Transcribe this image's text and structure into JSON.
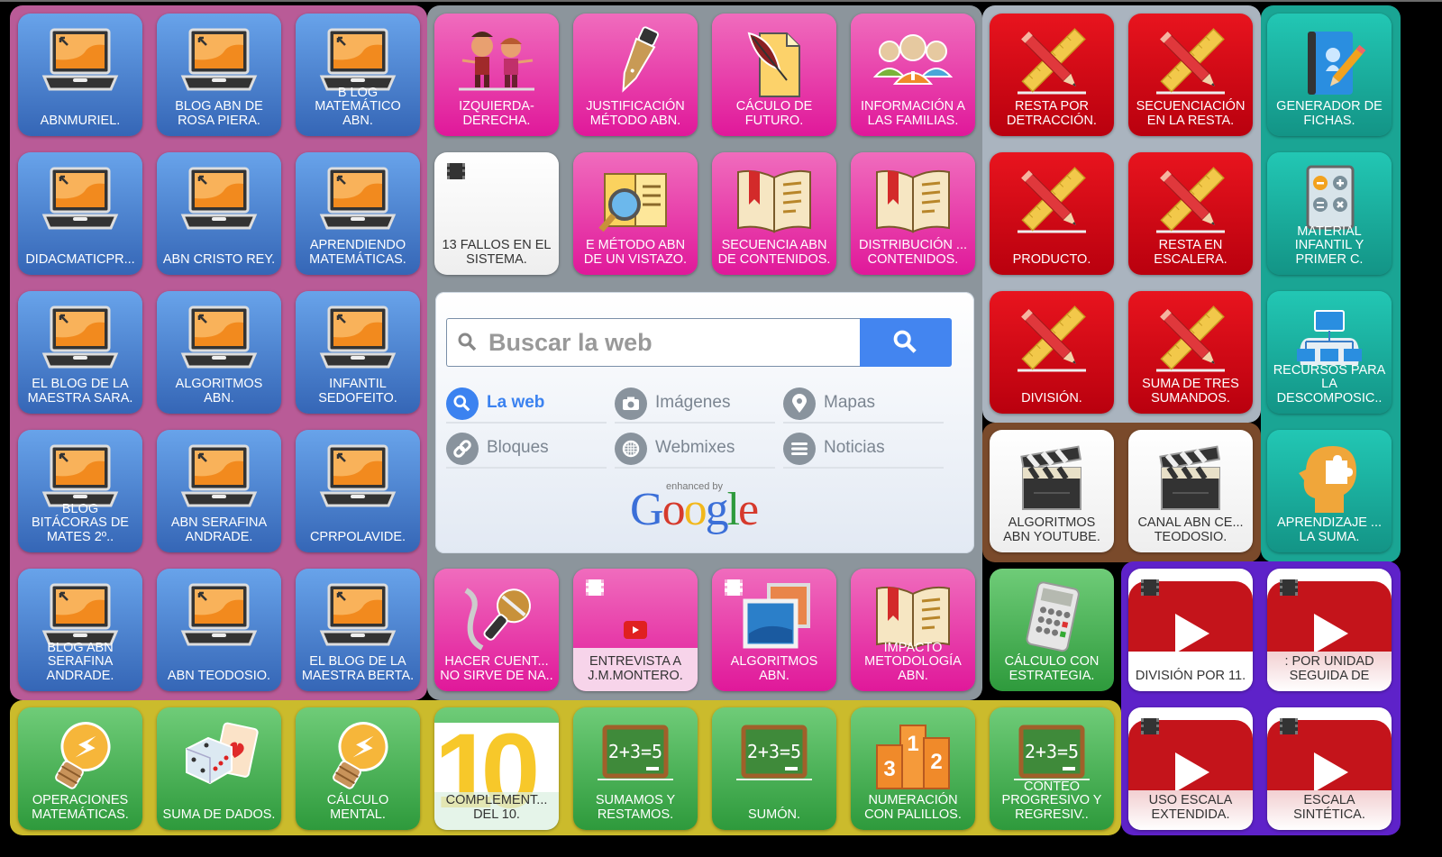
{
  "colors": {
    "group_blue_bg": "#b95b97",
    "group_pink_bg": "#8c959c",
    "group_red_bg": "#aab4bf",
    "group_teal_bg": "#1aa594",
    "group_brown_bg": "#7a4a2b",
    "group_yellow_bg": "#cbbb2c",
    "group_purple_bg": "#5e22c9",
    "search_accent": "#4385f0"
  },
  "tiles": {
    "abnmuriel": "ABNMURIEL.",
    "blog_rosa": "BLOG ABN DE\nROSA PIERA.",
    "blog_matematico": "B LOG\nMATEMÁTICO\nABN.",
    "didacmatic": "DIDACMATICPR...",
    "cristo_rey": "ABN CRISTO REY.",
    "aprendiendo": "APRENDIENDO\nMATEMÁTICAS.",
    "maestra_sara": "EL BLOG DE LA\nMAESTRA SARA.",
    "algoritmos_blog": "ALGORITMOS\nABN.",
    "sedofeito": "INFANTIL\nSEDOFEITO.",
    "bitacoras": "BLOG\nBITÁCORAS DE\nMATES  2º..",
    "serafina": "ABN SERAFINA\nANDRADE.",
    "cprpolavide": "CPRPOLAVIDE.",
    "blog_serafina": "BLOG ABN\nSERAFINA\nANDRADE.",
    "teodosio": "ABN TEODOSIO.",
    "maestra_berta": "EL BLOG DE LA\nMAESTRA BERTA.",
    "izquierda": "IZQUIERDA-\nDERECHA.",
    "justificacion": "JUSTIFICACIÓN\nMÉTODO ABN.",
    "caculo_futuro": "CÁCULO DE\nFUTURO.",
    "informacion": "INFORMACIÓN A\nLAS FAMILIAS.",
    "fallos": "13 FALLOS EN EL\nSISTEMA.",
    "vistazo": "E MÉTODO ABN\nDE UN VISTAZO.",
    "secuencia": "SECUENCIA ABN\nDE CONTENIDOS.",
    "distribucion": "DISTRIBUCIÓN ...\nCONTENIDOS.",
    "hacer_cuentas": "HACER CUENT...\nNO SIRVE DE NA..",
    "entrevista": "ENTREVISTA A\nJ.M.MONTERO.",
    "algoritmos_pink": "ALGORITMOS\nABN.",
    "impacto": "IMPACTO\nMETODOLOGÍA\nABN.",
    "resta_detraccion": "RESTA POR\nDETRACCIÓN.",
    "secuenciacion": "SECUENCIACIÓN\nEN LA RESTA.",
    "producto": "PRODUCTO.",
    "resta_escalera": "RESTA EN\nESCALERA.",
    "division": "DIVISIÓN.",
    "suma_tres": "SUMA DE TRES\nSUMANDOS.",
    "generador": "GENERADOR DE\nFICHAS.",
    "material_infantil": "MATERIAL\nINFANTIL Y\nPRIMER C.",
    "recursos": "RECURSOS PARA\nLA\nDESCOMPOSIC..",
    "aprendizaje": "APRENDIZAJE ...\nLA SUMA.",
    "algoritmos_youtube": "ALGORITMOS\nABN YOUTUBE.",
    "canal_abn": "CANAL ABN CE...\nTEODOSIO.",
    "calculo_estrategia": "CÁLCULO CON\nESTRATEGIA.",
    "division_11": "DIVISIÓN POR 11.",
    "por_unidad": ": POR UNIDAD\nSEGUIDA DE",
    "uso_escala": "USO ESCALA\nEXTENDIDA.",
    "escala_sintetica": "ESCALA\nSINTÉTICA.",
    "operaciones": "OPERACIONES\nMATEMÁTICAS.",
    "suma_dados": "SUMA DE DADOS.",
    "calculo_mental": "CÁLCULO\nMENTAL.",
    "complementos": "COMPLEMENT...\nDEL 10.",
    "sumamos": "SUMAMOS Y\nRESTAMOS.",
    "sumon": "SUMÓN.",
    "numeracion": "NUMERACIÓN\nCON PALILLOS.",
    "conteo": "CONTEO\nPROGRESIVO Y\nREGRESIV.."
  },
  "search": {
    "placeholder": "Buscar la web",
    "options": [
      "La web",
      "Imágenes",
      "Mapas",
      "Bloques",
      "Webmixes",
      "Noticias"
    ],
    "selected": "La web",
    "enhanced_by": "enhanced by",
    "logo": "Google"
  },
  "icons": {
    "chalkboard_text": "2+3=5",
    "podium_numbers": [
      "3",
      "1",
      "2"
    ],
    "ten_text": "10"
  }
}
